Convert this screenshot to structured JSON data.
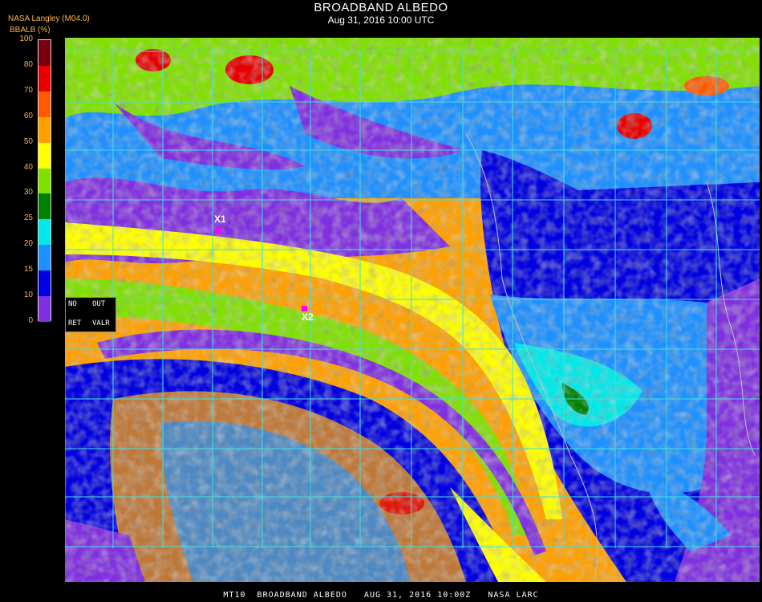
{
  "header": {
    "title": "BROADBAND ALBEDO",
    "subtitle": "Aug 31, 2016 10:00 UTC",
    "organization": "NASA Langley (M04.0)",
    "variable_unit": "BBALB (%)"
  },
  "legend": {
    "ticks": [
      "100",
      "80",
      "70",
      "60",
      "50",
      "40",
      "30",
      "25",
      "20",
      "15",
      "10",
      "0"
    ],
    "bands": [
      {
        "from": 80,
        "to": 100,
        "color": "#7a0010"
      },
      {
        "from": 70,
        "to": 80,
        "color": "#e80000"
      },
      {
        "from": 60,
        "to": 70,
        "color": "#ff5a00"
      },
      {
        "from": 50,
        "to": 60,
        "color": "#ffa000"
      },
      {
        "from": 40,
        "to": 50,
        "color": "#ffff00"
      },
      {
        "from": 30,
        "to": 40,
        "color": "#80e000"
      },
      {
        "from": 25,
        "to": 30,
        "color": "#008000"
      },
      {
        "from": 20,
        "to": 25,
        "color": "#00e8e8"
      },
      {
        "from": 15,
        "to": 20,
        "color": "#1e90ff"
      },
      {
        "from": 10,
        "to": 15,
        "color": "#0000e0"
      },
      {
        "from": 0,
        "to": 10,
        "color": "#8030e0"
      }
    ]
  },
  "info_box": {
    "no": "NO",
    "out": "OUT",
    "ret": "RET",
    "valr": "VALR"
  },
  "markers": [
    {
      "label": "X1",
      "name": "marker-x1"
    },
    {
      "label": "X2",
      "name": "marker-x2"
    }
  ],
  "map": {
    "grid_color": "#40e0e0"
  },
  "footer": "MT10  BROADBAND ALBEDO   AUG 31, 2016 10:00Z   NASA LARC"
}
